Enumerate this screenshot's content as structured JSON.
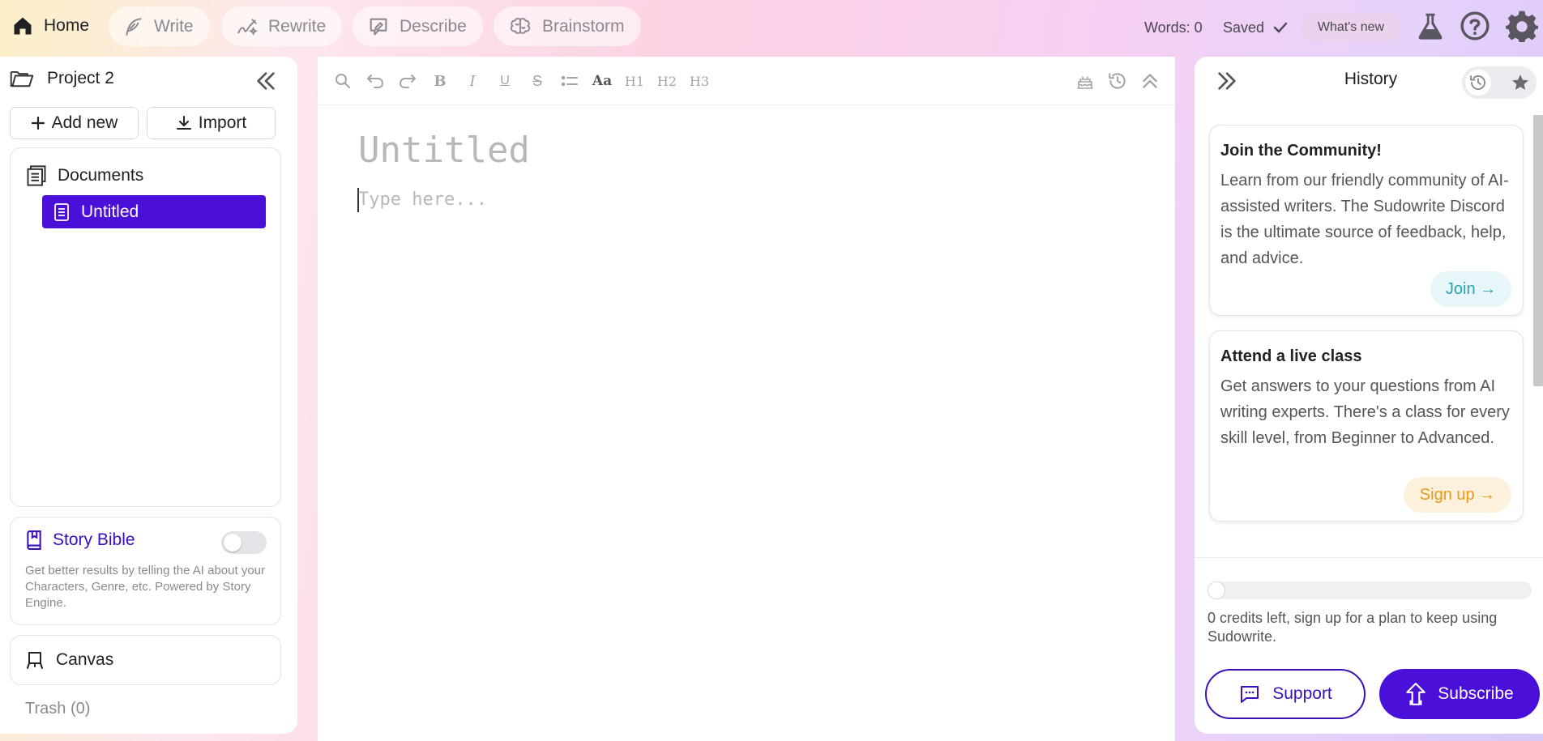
{
  "colors": {
    "accent": "#4a0fd8",
    "story_bible": "#3a10b8",
    "join": "#2aa3b8",
    "sign_up": "#e89a1a"
  },
  "nav": {
    "home": "Home",
    "write": "Write",
    "rewrite": "Rewrite",
    "describe": "Describe",
    "brainstorm": "Brainstorm",
    "icons": [
      "home-icon",
      "feather-icon",
      "rewrite-icon",
      "describe-icon",
      "brain-icon"
    ]
  },
  "status": {
    "words": "Words: 0",
    "saved": "Saved",
    "whats_new": "What's new"
  },
  "left": {
    "project_name": "Project 2",
    "add_new": "Add new",
    "import": "Import",
    "documents_label": "Documents",
    "documents": [
      {
        "title": "Untitled",
        "selected": true
      }
    ],
    "story_bible": {
      "label": "Story Bible",
      "enabled": false,
      "description": "Get better results by telling the AI about your Characters, Genre, etc. Powered by Story Engine."
    },
    "canvas": "Canvas",
    "trash": "Trash (0)"
  },
  "editor": {
    "toolbar": {
      "h1": "H1",
      "h2": "H2",
      "h3": "H3",
      "font": "Aa",
      "bold": "B",
      "italic": "I",
      "underline": "U",
      "strike": "S"
    },
    "title_placeholder": "Untitled",
    "body_placeholder": "Type here..."
  },
  "right": {
    "title": "History",
    "cards": [
      {
        "title": "Join the Community!",
        "text": "Learn from our friendly community of AI-assisted writers. The Sudowrite Discord is the ultimate source of feedback, help, and advice.",
        "button": "Join →"
      },
      {
        "title": "Attend a live class",
        "text": "Get answers to your questions from AI writing experts. There's a class for every skill level, from Beginner to Advanced.",
        "button": "Sign up →"
      }
    ],
    "credits_fraction": 0,
    "credits_text": "0 credits left, sign up for a plan to keep using Sudowrite.",
    "support": "Support",
    "subscribe": "Subscribe"
  }
}
